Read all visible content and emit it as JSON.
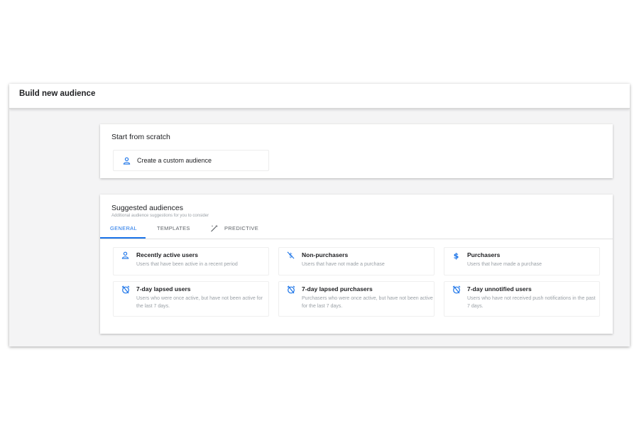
{
  "header": {
    "title": "Build new audience"
  },
  "scratch": {
    "title": "Start from scratch",
    "item": {
      "label": "Create a custom audience",
      "icon": "person-icon"
    }
  },
  "suggested": {
    "title": "Suggested audiences",
    "subtitle": "Additional audience suggestions for you to consider",
    "tabs": [
      {
        "label": "GENERAL",
        "active": true
      },
      {
        "label": "TEMPLATES",
        "active": false
      },
      {
        "label": "PREDICTIVE",
        "active": false,
        "icon": "magic-wand-icon"
      }
    ],
    "items": [
      {
        "title": "Recently active users",
        "desc": "Users that have been active in a recent period",
        "icon": "person-icon"
      },
      {
        "title": "Non-purchasers",
        "desc": "Users that have not made a purchase",
        "icon": "no-purchase-icon"
      },
      {
        "title": "Purchasers",
        "desc": "Users that have made a purchase",
        "icon": "dollar-icon"
      },
      {
        "title": "7-day lapsed users",
        "desc": "Users who were once active, but have not been active for the last 7 days.",
        "icon": "lapsed-timer-icon"
      },
      {
        "title": "7-day lapsed purchasers",
        "desc": "Purchasers who were once active, but have not been active for the last 7 days.",
        "icon": "lapsed-timer-icon"
      },
      {
        "title": "7-day unnotified users",
        "desc": "Users who have not received push notifications in the past 7 days.",
        "icon": "lapsed-timer-icon"
      }
    ]
  },
  "colors": {
    "accent": "#1a73e8",
    "muted": "#9aa0a6",
    "background": "#f4f4f5"
  }
}
